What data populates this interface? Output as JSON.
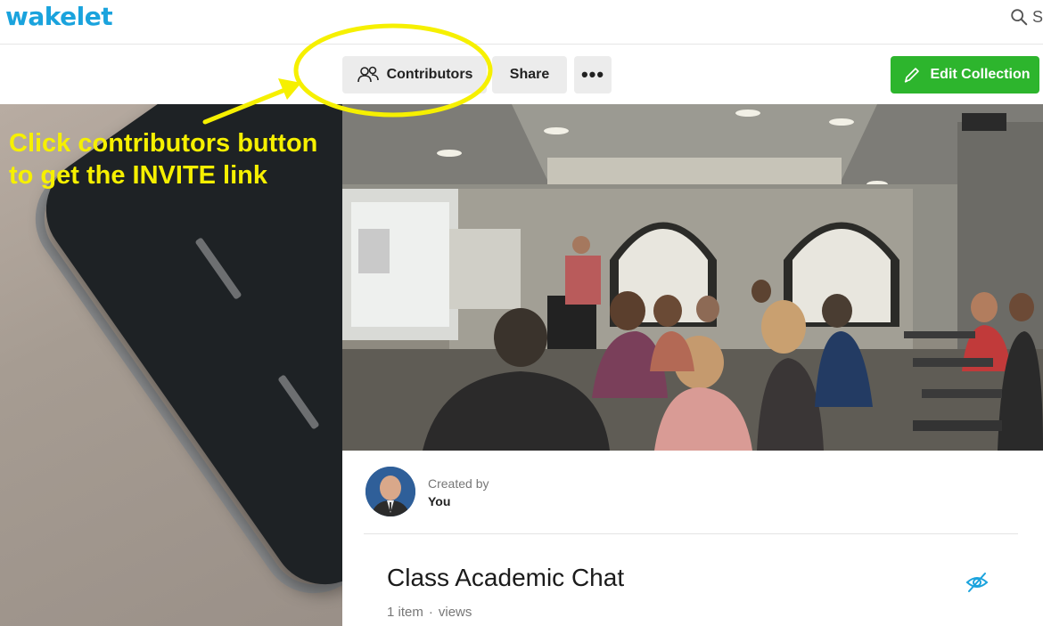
{
  "app": {
    "logo": "wakelet"
  },
  "header": {
    "search_label": "S"
  },
  "toolbar": {
    "contributors_label": "Contributors",
    "share_label": "Share",
    "more_label": "•••",
    "edit_label": "Edit Collection"
  },
  "annotation": {
    "line1": "Click contributors button",
    "line2": "to get the INVITE link",
    "color": "#f6f000"
  },
  "collection": {
    "created_by_label": "Created by",
    "creator_name": "You",
    "title": "Class Academic Chat",
    "item_count": "1 item",
    "separator": "·",
    "views_label": "views"
  },
  "colors": {
    "brand": "#1aa3dd",
    "edit_button": "#2db52d",
    "visibility_icon": "#1aa3dd"
  },
  "icons": {
    "search": "search-icon",
    "contributors": "people-icon",
    "edit": "pencil-icon",
    "visibility": "eye-slash-icon"
  }
}
